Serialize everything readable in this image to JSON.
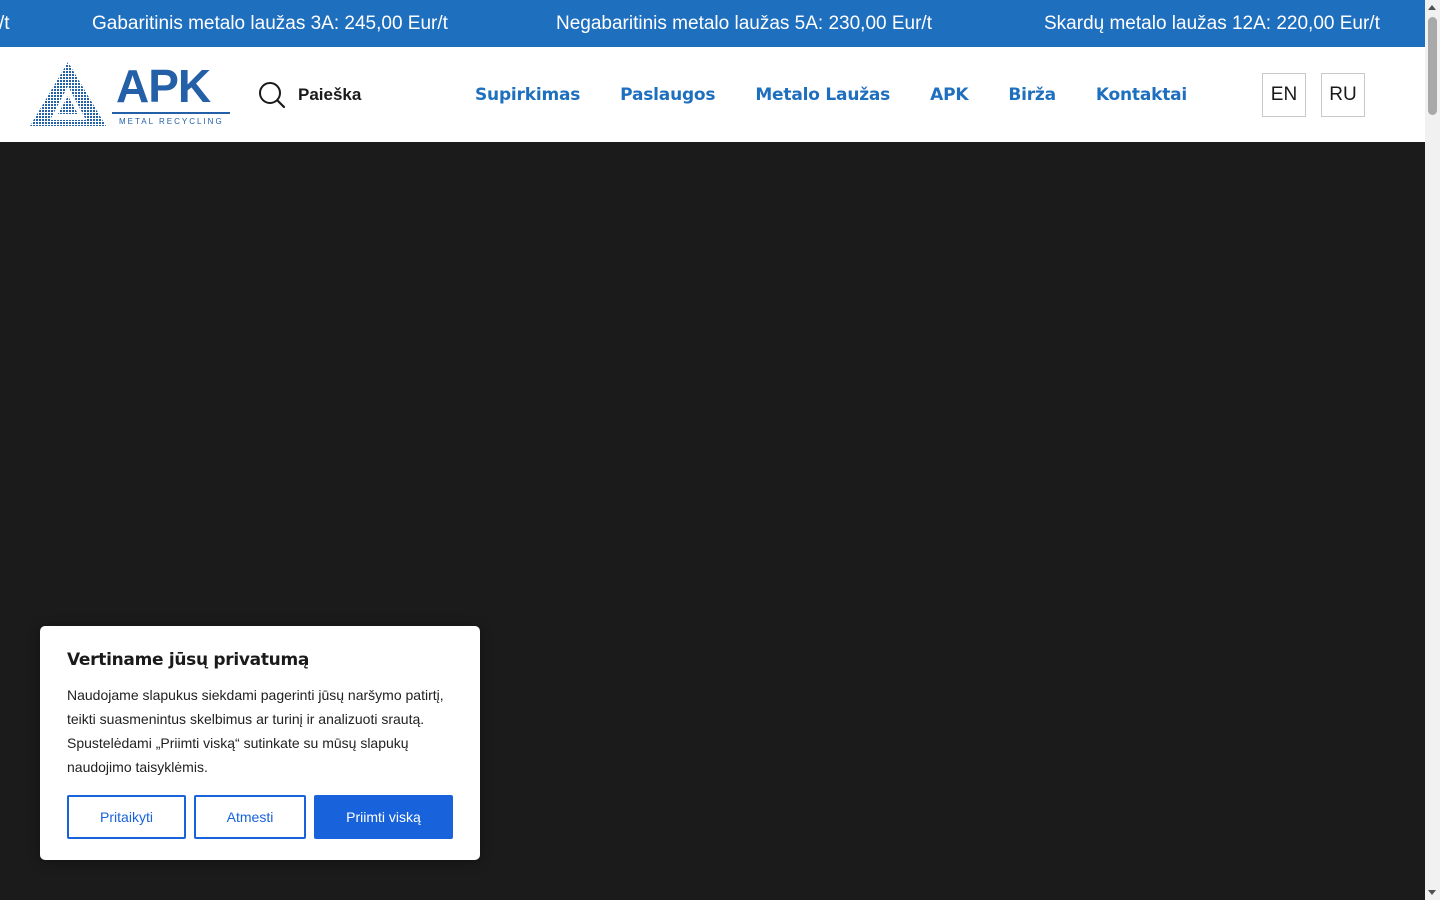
{
  "ticker": {
    "items": [
      "/t",
      "Gabaritinis metalo laužas 3A: 245,00 Eur/t",
      "Negabaritinis metalo laužas 5A: 230,00 Eur/t",
      "Skardų metalo laužas 12A: 220,00 Eur/t"
    ]
  },
  "header": {
    "logo": {
      "wordmark": "APK",
      "subtitle": "METAL RECYCLING"
    },
    "search_label": "Paieška",
    "nav": [
      "Supirkimas",
      "Paslaugos",
      "Metalo Laužas",
      "APK",
      "Birža",
      "Kontaktai"
    ],
    "languages": [
      "EN",
      "RU"
    ]
  },
  "cookie": {
    "title": "Vertiname jūsų privatumą",
    "text": "Naudojame slapukus siekdami pagerinti jūsų naršymo patirtį, teikti suasmenintus skelbimus ar turinį ir analizuoti srautą. Spustelėdami „Priimti viską“ sutinkate su mūsų slapukų naudojimo taisyklėmis.",
    "buttons": {
      "customize": "Pritaikyti",
      "reject": "Atmesti",
      "accept": "Priimti viską"
    }
  },
  "colors": {
    "ticker_bg": "#1f6fbf",
    "brand_blue": "#2460a7",
    "nav_blue": "#1f6fbf",
    "hero_bg": "#1b1b1b",
    "accept_button": "#1863dc"
  },
  "icons": {
    "search": "search-icon",
    "logo_mark": "triangle-logo-icon"
  }
}
